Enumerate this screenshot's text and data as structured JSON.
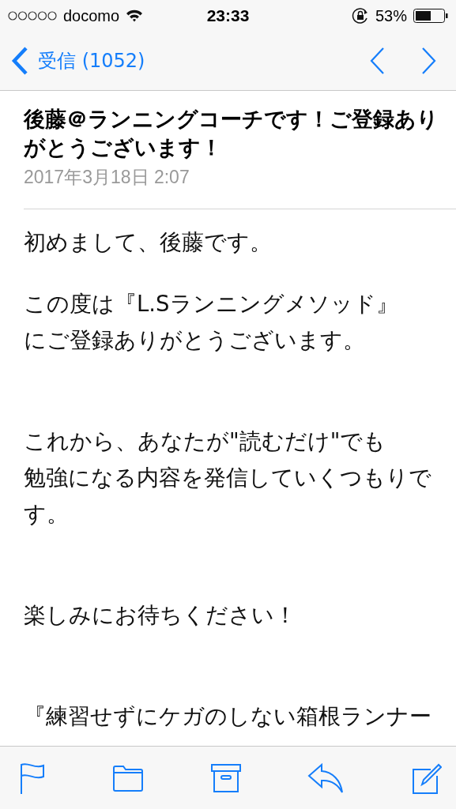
{
  "status_bar": {
    "carrier": "docomo",
    "time": "23:33",
    "battery_text": "53%"
  },
  "nav": {
    "back_label": "受信 (1052)"
  },
  "message": {
    "subject": "後藤＠ランニングコーチです！ご登録ありがとうございます！",
    "date": "2017年3月18日 2:07"
  },
  "body": [
    {
      "lines": [
        "初めまして、後藤です。"
      ]
    },
    {
      "lines": [
        "この度は『L.Sランニングメソッド』",
        "にご登録ありがとうございます。"
      ]
    },
    {
      "lines": [
        "これから、あなたが\"読むだけ\"でも",
        "勉強になる内容を発信していくつもりで",
        "す。"
      ]
    },
    {
      "lines": [
        "楽しみにお待ちください！"
      ]
    },
    {
      "lines": [
        "『練習せずにケガのしない箱根ランナー"
      ]
    }
  ]
}
